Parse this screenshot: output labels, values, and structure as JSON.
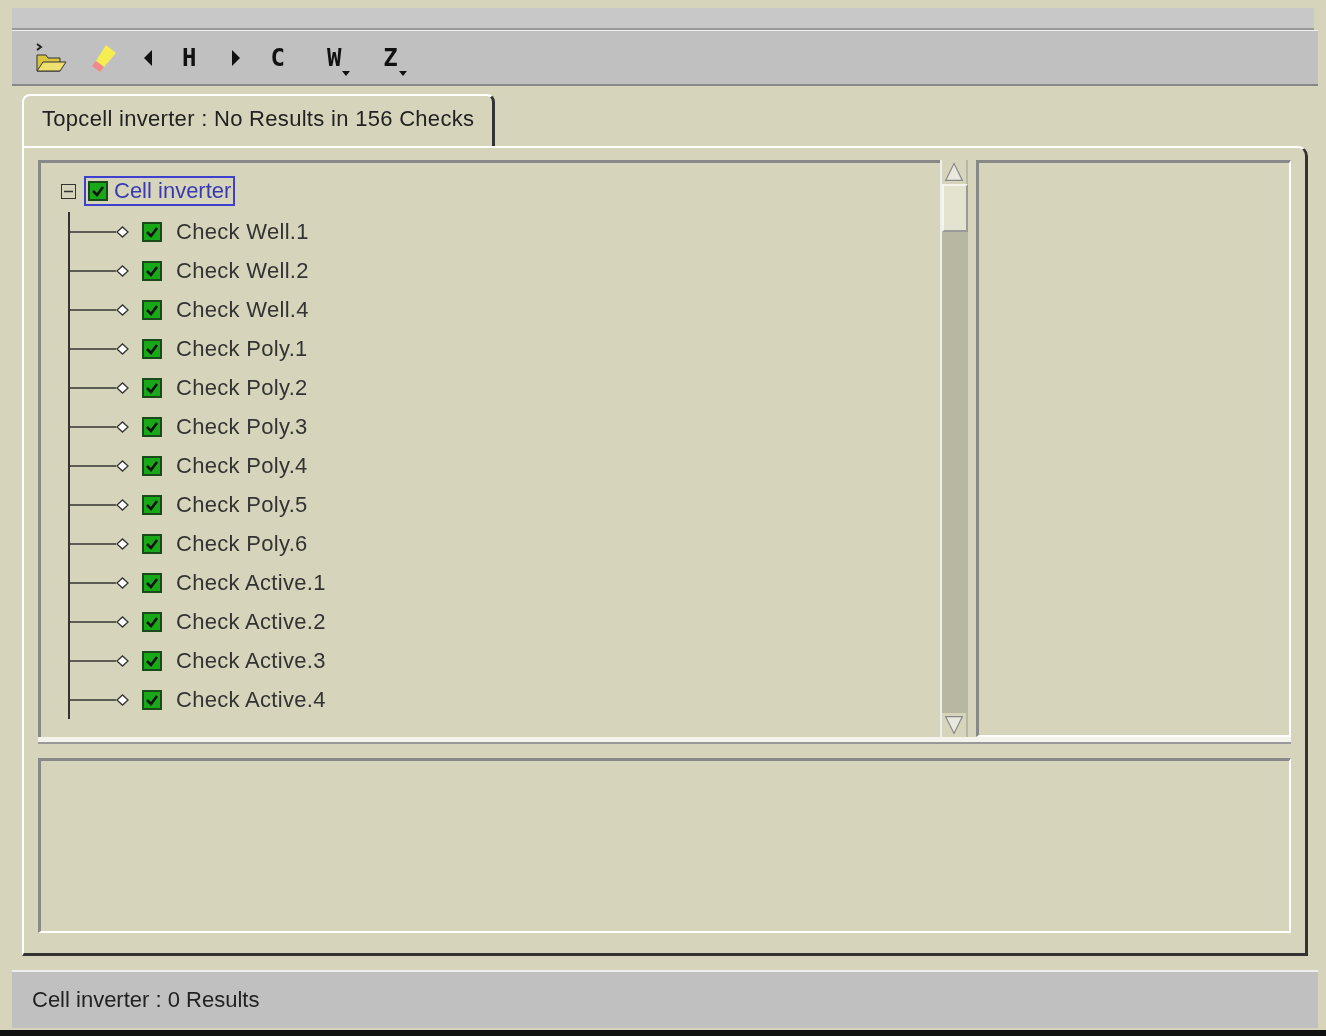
{
  "toolbar": [
    {
      "kind": "folder"
    },
    {
      "kind": "highlighter"
    },
    {
      "kind": "back"
    },
    {
      "kind": "text",
      "label": "H",
      "has_menu": false
    },
    {
      "kind": "forward"
    },
    {
      "kind": "text",
      "label": "C",
      "has_menu": false
    },
    {
      "kind": "text",
      "label": "W",
      "has_menu": true
    },
    {
      "kind": "text",
      "label": "Z",
      "has_menu": true
    }
  ],
  "tabs": [
    {
      "label": "Topcell inverter : No Results in 156 Checks",
      "selected": true
    }
  ],
  "tree": {
    "label": "Cell inverter",
    "checked": true,
    "expanded": true,
    "selected": true,
    "children": [
      {
        "label": "Check Well.1",
        "checked": true
      },
      {
        "label": "Check Well.2",
        "checked": true
      },
      {
        "label": "Check Well.4",
        "checked": true
      },
      {
        "label": "Check Poly.1",
        "checked": true
      },
      {
        "label": "Check Poly.2",
        "checked": true
      },
      {
        "label": "Check Poly.3",
        "checked": true
      },
      {
        "label": "Check Poly.4",
        "checked": true
      },
      {
        "label": "Check Poly.5",
        "checked": true
      },
      {
        "label": "Check Poly.6",
        "checked": true
      },
      {
        "label": "Check Active.1",
        "checked": true
      },
      {
        "label": "Check Active.2",
        "checked": true
      },
      {
        "label": "Check Active.3",
        "checked": true
      },
      {
        "label": "Check Active.4",
        "checked": true
      }
    ]
  },
  "status_bar": {
    "text": "Cell inverter : 0 Results"
  }
}
